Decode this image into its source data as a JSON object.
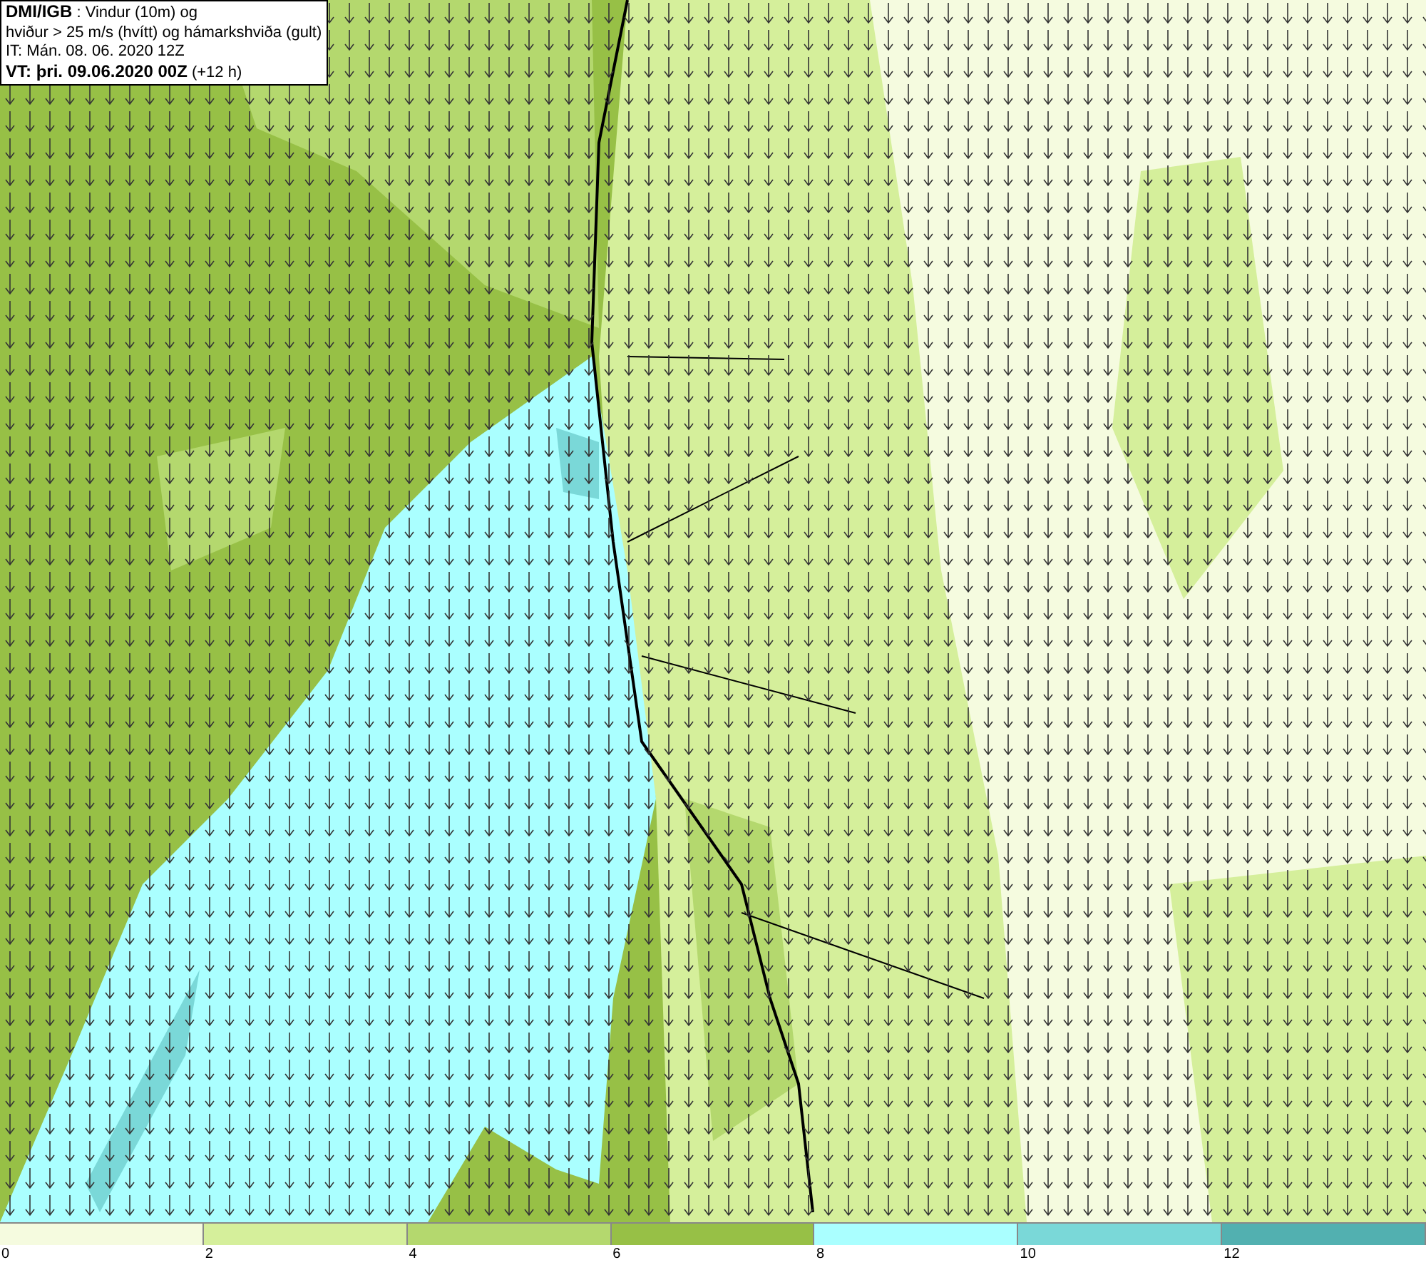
{
  "header": {
    "lines": [
      "**DMI/IGB** : Vindur (10m) og",
      "hviður > 25 m/s (hvítt) og hámarkshviða (gult)",
      "IT: Mán. 08. 06. 2020 12Z",
      "**VT: þri. 09.06.2020 00Z** (+12 h)"
    ]
  },
  "legend": {
    "bins": [
      {
        "color": "#f5fbdf"
      },
      {
        "color": "#d5ef9b"
      },
      {
        "color": "#b4d86e"
      },
      {
        "color": "#97c046"
      },
      {
        "color": "#aaffff"
      },
      {
        "color": "#7ad8d8"
      },
      {
        "color": "#52b0b0"
      }
    ],
    "labels": [
      "0",
      "2",
      "4",
      "6",
      "8",
      "10",
      "12"
    ]
  }
}
